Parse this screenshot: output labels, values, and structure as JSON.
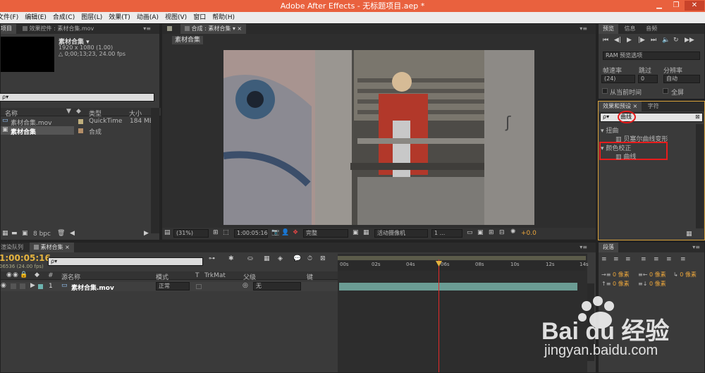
{
  "app": {
    "title": "Adobe After Effects - 无标题项目.aep *"
  },
  "menu": [
    "文件(F)",
    "编辑(E)",
    "合成(C)",
    "图层(L)",
    "效果(T)",
    "动画(A)",
    "视图(V)",
    "窗口",
    "帮助(H)"
  ],
  "project": {
    "tabs": [
      "项目",
      "效果控件 : 素材合集.mov"
    ],
    "item_name": "素材合集 ▾",
    "item_res": "1920 x 1080 (1.00)",
    "item_dur": "△ 0;00;13;23, 24.00 fps",
    "search_placeholder": "ρ▾",
    "headers": [
      "名称",
      "类型",
      "大小"
    ],
    "rows": [
      {
        "name": "素材合集.mov",
        "type": "QuickTime",
        "size": "184 MB"
      },
      {
        "name": "素材合集",
        "type": "合成",
        "size": ""
      }
    ],
    "bpc": "8 bpc"
  },
  "comp": {
    "tab": "合成 : 素材合集",
    "chip": "素材合集",
    "zoom": "(31%)",
    "time": "1:00:05:16",
    "quality": "完整",
    "camera": "活动摄像机",
    "views": "1 ...",
    "exposure": "+0.0"
  },
  "preview": {
    "tabs": [
      "预览",
      "信息",
      "音频"
    ],
    "ram": "RAM 预览选项",
    "labels": [
      "帧速率",
      "跳过",
      "分辨率"
    ],
    "values": [
      "(24)",
      "0",
      "自动"
    ],
    "chk1": "从当前时间",
    "chk2": "全屏"
  },
  "effects": {
    "tabs": [
      "效果和预设",
      "字符"
    ],
    "search": "曲线",
    "groups": [
      {
        "name": "扭曲",
        "item": "贝塞尔曲线变形"
      },
      {
        "name": "颜色校正",
        "item": "曲线"
      }
    ]
  },
  "timeline": {
    "tabs": [
      "渲染队列",
      "素材合集"
    ],
    "time": "1:00:05:16",
    "frame": "06536 (24.00 fps)",
    "search_placeholder": "ρ▾",
    "headers": [
      "#",
      "源名称",
      "模式",
      "T",
      "TrkMat",
      "父级",
      "键"
    ],
    "layer": {
      "num": "1",
      "name": "素材合集.mov",
      "mode": "正常",
      "parent": "无"
    },
    "ruler": [
      "00s",
      "02s",
      "04s",
      "06s",
      "08s",
      "10s",
      "12s",
      "14s"
    ]
  },
  "paragraph": {
    "tab": "段落",
    "fields": [
      "0 像素",
      "0 像素",
      "0 像素",
      "0 像素",
      "0 像素"
    ]
  },
  "watermark": {
    "brand": "Bai du 经验",
    "url": "jingyan.baidu.com"
  },
  "colors": {
    "accent": "#e6b43e",
    "titlebar": "#e9613e",
    "highlight_red": "#e81c1c",
    "track": "#6b9c94"
  }
}
